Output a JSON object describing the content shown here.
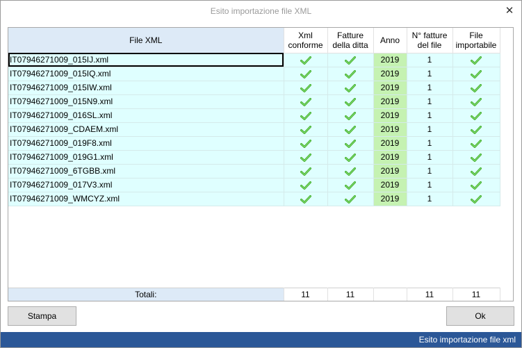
{
  "window": {
    "title": "Esito importazione file XML",
    "close_glyph": "✕"
  },
  "grid": {
    "columns": [
      {
        "line1": "File XML",
        "line2": ""
      },
      {
        "line1": "Xml",
        "line2": "conforme"
      },
      {
        "line1": "Fatture",
        "line2": "della ditta"
      },
      {
        "line1": "Anno",
        "line2": ""
      },
      {
        "line1": "N° fatture",
        "line2": "del file"
      },
      {
        "line1": "File",
        "line2": "importabile"
      }
    ],
    "rows": [
      {
        "file": "IT07946271009_015IJ.xml",
        "xml_conforme": true,
        "fatture_ditta": true,
        "anno": "2019",
        "n_fatture": "1",
        "importabile": true
      },
      {
        "file": "IT07946271009_015IQ.xml",
        "xml_conforme": true,
        "fatture_ditta": true,
        "anno": "2019",
        "n_fatture": "1",
        "importabile": true
      },
      {
        "file": "IT07946271009_015IW.xml",
        "xml_conforme": true,
        "fatture_ditta": true,
        "anno": "2019",
        "n_fatture": "1",
        "importabile": true
      },
      {
        "file": "IT07946271009_015N9.xml",
        "xml_conforme": true,
        "fatture_ditta": true,
        "anno": "2019",
        "n_fatture": "1",
        "importabile": true
      },
      {
        "file": "IT07946271009_016SL.xml",
        "xml_conforme": true,
        "fatture_ditta": true,
        "anno": "2019",
        "n_fatture": "1",
        "importabile": true
      },
      {
        "file": "IT07946271009_CDAEM.xml",
        "xml_conforme": true,
        "fatture_ditta": true,
        "anno": "2019",
        "n_fatture": "1",
        "importabile": true
      },
      {
        "file": "IT07946271009_019F8.xml",
        "xml_conforme": true,
        "fatture_ditta": true,
        "anno": "2019",
        "n_fatture": "1",
        "importabile": true
      },
      {
        "file": "IT07946271009_019G1.xml",
        "xml_conforme": true,
        "fatture_ditta": true,
        "anno": "2019",
        "n_fatture": "1",
        "importabile": true
      },
      {
        "file": "IT07946271009_6TGBB.xml",
        "xml_conforme": true,
        "fatture_ditta": true,
        "anno": "2019",
        "n_fatture": "1",
        "importabile": true
      },
      {
        "file": "IT07946271009_017V3.xml",
        "xml_conforme": true,
        "fatture_ditta": true,
        "anno": "2019",
        "n_fatture": "1",
        "importabile": true
      },
      {
        "file": "IT07946271009_WMCYZ.xml",
        "xml_conforme": true,
        "fatture_ditta": true,
        "anno": "2019",
        "n_fatture": "1",
        "importabile": true
      }
    ],
    "selected_row": 0,
    "totals": {
      "label": "Totali:",
      "xml_conforme": "11",
      "fatture_ditta": "11",
      "anno": "",
      "n_fatture": "11",
      "importabile": "11"
    }
  },
  "buttons": {
    "print_label": "Stampa",
    "ok_label": "Ok"
  },
  "statusbar": {
    "text": "Esito importazione file xml"
  },
  "icons": {
    "check": "check-icon"
  },
  "colors": {
    "row_bg": "#dfffff",
    "year_bg": "#c5f2b2",
    "header_first_bg": "#ddeaf7",
    "check_green": "#3fae29",
    "statusbar_bg": "#2b5797"
  }
}
